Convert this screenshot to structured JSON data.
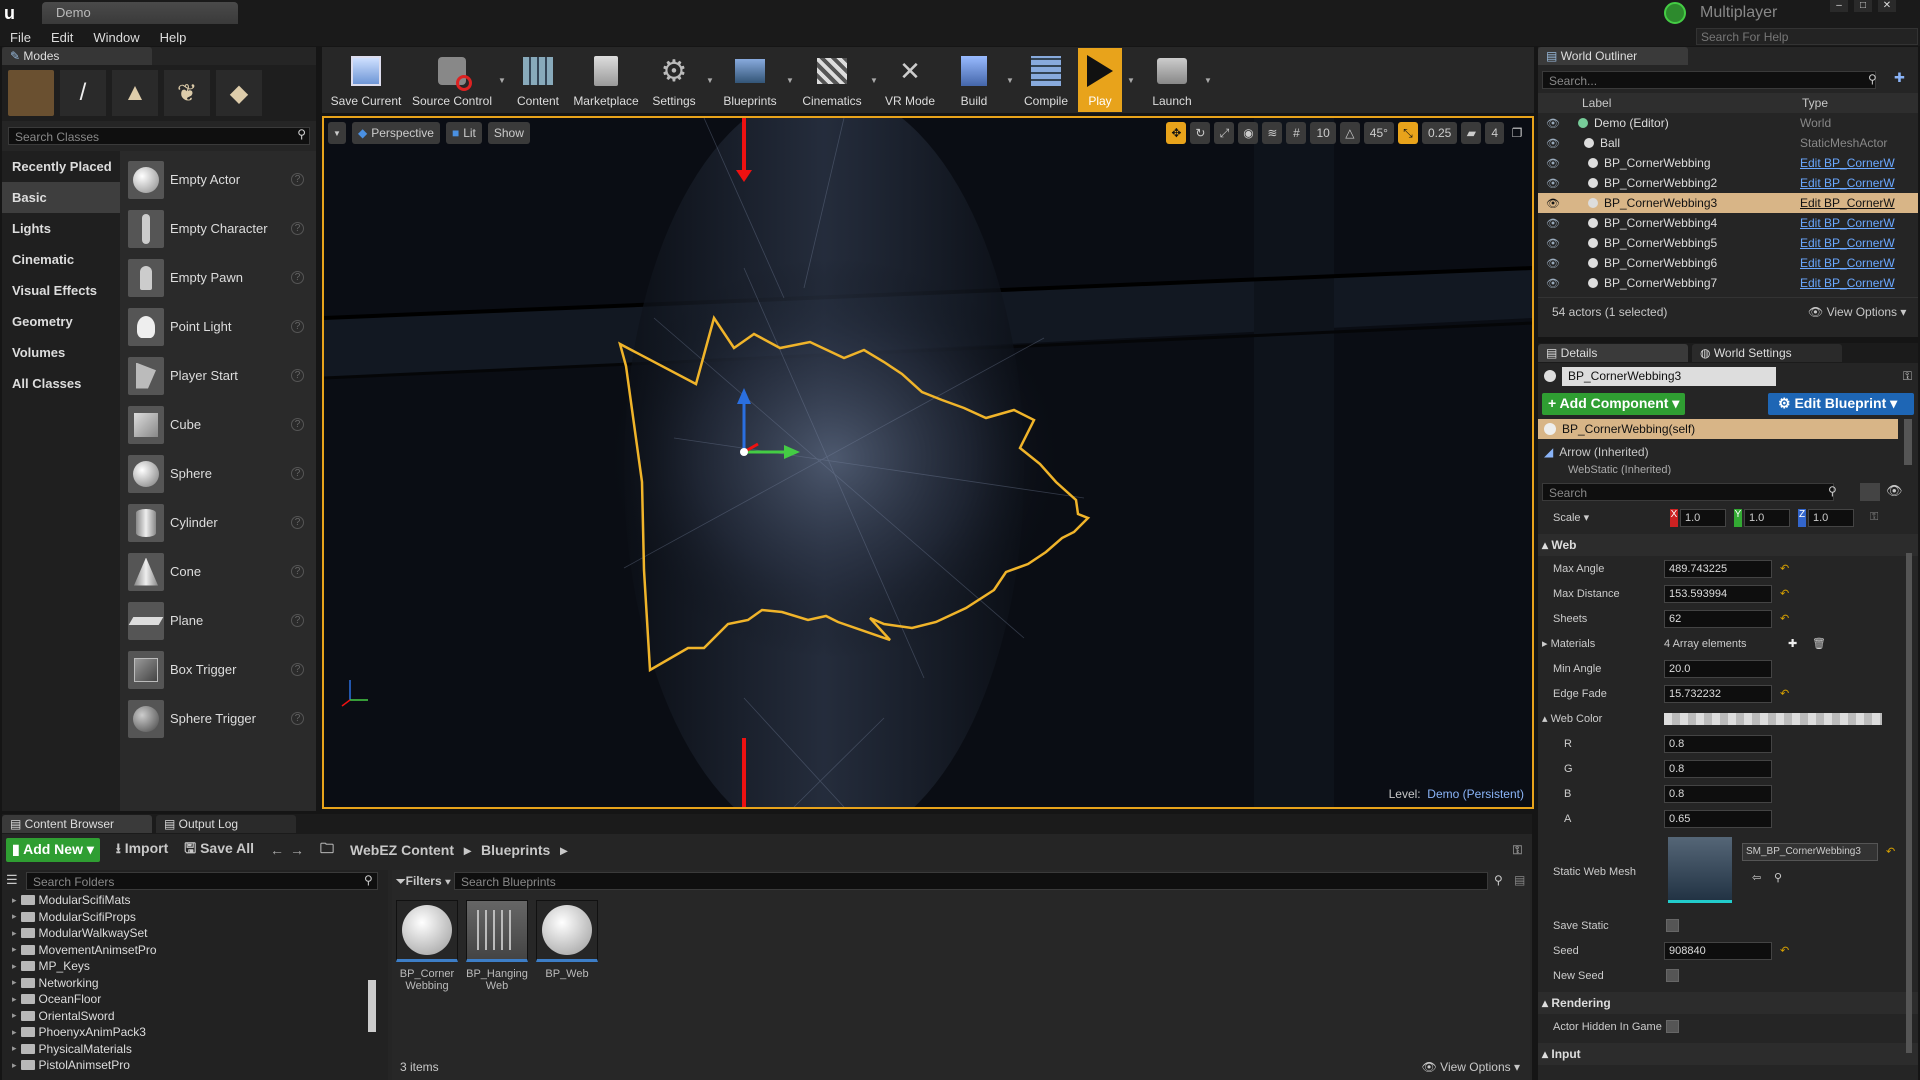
{
  "window": {
    "tab": "Demo",
    "multiplayer": "Multiplayer",
    "search_help": "Search For Help"
  },
  "menu": [
    "File",
    "Edit",
    "Window",
    "Help"
  ],
  "modes": {
    "title": "Modes",
    "search_placeholder": "Search Classes",
    "categories": [
      "Recently Placed",
      "Basic",
      "Lights",
      "Cinematic",
      "Visual Effects",
      "Geometry",
      "Volumes",
      "All Classes"
    ],
    "items": [
      "Empty Actor",
      "Empty Character",
      "Empty Pawn",
      "Point Light",
      "Player Start",
      "Cube",
      "Sphere",
      "Cylinder",
      "Cone",
      "Plane",
      "Box Trigger",
      "Sphere Trigger"
    ]
  },
  "toolbar": [
    "Save Current",
    "Source Control",
    "Content",
    "Marketplace",
    "Settings",
    "Blueprints",
    "Cinematics",
    "VR Mode",
    "Build",
    "Compile",
    "Play",
    "Launch"
  ],
  "viewport": {
    "perspective": "Perspective",
    "lit": "Lit",
    "show": "Show",
    "grid": "10",
    "angle": "45°",
    "scale": "0.25",
    "cam": "4",
    "level_label": "Level:",
    "level_name": "Demo (Persistent)"
  },
  "outliner": {
    "title": "World Outliner",
    "search_placeholder": "Search...",
    "col_label": "Label",
    "col_type": "Type",
    "rows": [
      {
        "label": "Demo (Editor)",
        "type": "World",
        "link": false
      },
      {
        "label": "Ball",
        "type": "StaticMeshActor",
        "link": false
      },
      {
        "label": "BP_CornerWebbing",
        "type": "Edit BP_CornerW",
        "link": true
      },
      {
        "label": "BP_CornerWebbing2",
        "type": "Edit BP_CornerW",
        "link": true
      },
      {
        "label": "BP_CornerWebbing3",
        "type": "Edit BP_CornerW",
        "link": true
      },
      {
        "label": "BP_CornerWebbing4",
        "type": "Edit BP_CornerW",
        "link": true
      },
      {
        "label": "BP_CornerWebbing5",
        "type": "Edit BP_CornerW",
        "link": true
      },
      {
        "label": "BP_CornerWebbing6",
        "type": "Edit BP_CornerW",
        "link": true
      },
      {
        "label": "BP_CornerWebbing7",
        "type": "Edit BP_CornerW",
        "link": true
      }
    ],
    "status": "54 actors (1 selected)",
    "view_options": "View Options"
  },
  "details": {
    "tab_details": "Details",
    "tab_world": "World Settings",
    "name": "BP_CornerWebbing3",
    "add_component": "+ Add Component",
    "edit_blueprint": "Edit Blueprint",
    "comp_self": "BP_CornerWebbing(self)",
    "comp_arrow": "Arrow (Inherited)",
    "comp_partial": "WebStatic (Inherited)",
    "search_placeholder": "Search",
    "scale_label": "Scale",
    "scale_x": "1.0",
    "scale_y": "1.0",
    "scale_z": "1.0",
    "section_web": "Web",
    "props": [
      {
        "label": "Max Angle",
        "value": "489.743225"
      },
      {
        "label": "Max Distance",
        "value": "153.593994"
      },
      {
        "label": "Sheets",
        "value": "62"
      }
    ],
    "materials_label": "Materials",
    "materials_value": "4 Array elements",
    "props2": [
      {
        "label": "Min Angle",
        "value": "20.0"
      },
      {
        "label": "Edge Fade",
        "value": "15.732232"
      }
    ],
    "web_color": "Web Color",
    "rgba": [
      {
        "label": "R",
        "value": "0.8"
      },
      {
        "label": "G",
        "value": "0.8"
      },
      {
        "label": "B",
        "value": "0.8"
      },
      {
        "label": "A",
        "value": "0.65"
      }
    ],
    "static_mesh_label": "Static Web Mesh",
    "static_mesh_value": "SM_BP_CornerWebbing3",
    "save_static": "Save Static",
    "seed_label": "Seed",
    "seed_value": "908840",
    "new_seed": "New Seed",
    "section_rendering": "Rendering",
    "hidden_in_game": "Actor Hidden In Game",
    "section_input": "Input"
  },
  "content_browser": {
    "tab": "Content Browser",
    "tab_output": "Output Log",
    "add_new": "Add New",
    "import": "Import",
    "save_all": "Save All",
    "path": [
      "WebEZ Content",
      "Blueprints"
    ],
    "search_folders": "Search Folders",
    "filters": "Filters",
    "search_blueprints": "Search Blueprints",
    "folders": [
      "ModularScifiMats",
      "ModularScifiProps",
      "ModularWalkwaySet",
      "MovementAnimsetPro",
      "MP_Keys",
      "Networking",
      "OceanFloor",
      "OrientalSword",
      "PhoenyxAnimPack3",
      "PhysicalMaterials",
      "PistolAnimsetPro"
    ],
    "assets": [
      {
        "l1": "BP_Corner",
        "l2": "Webbing"
      },
      {
        "l1": "BP_Hanging",
        "l2": "Web"
      },
      {
        "l1": "BP_Web",
        "l2": ""
      }
    ],
    "items_count": "3 items",
    "view_options": "View Options"
  },
  "colors": {
    "accent": "#f0b42a",
    "link": "#6aa8ff",
    "selected_row": "#d8b587",
    "green": "#2f9e32",
    "blue": "#1e66b5"
  }
}
